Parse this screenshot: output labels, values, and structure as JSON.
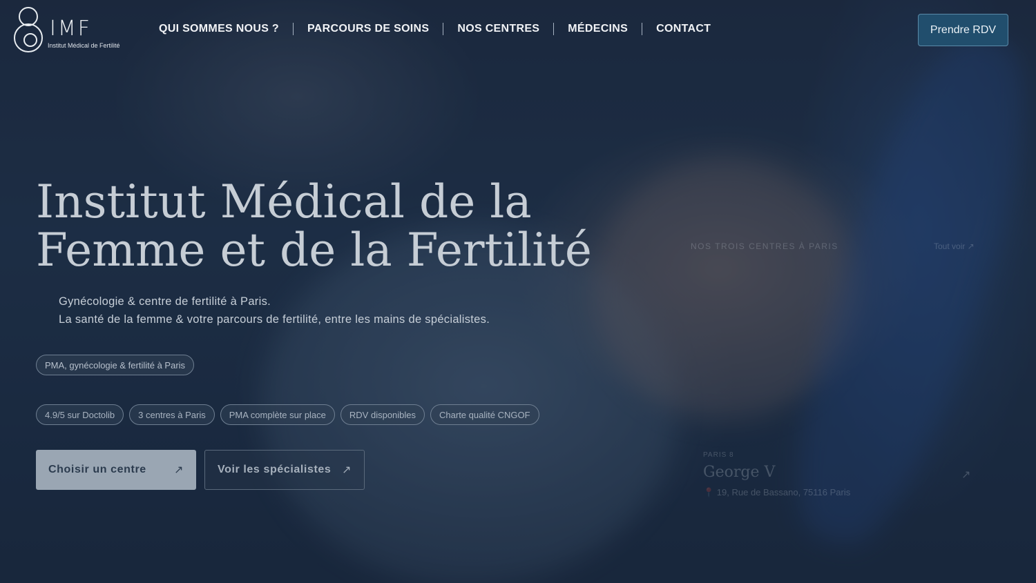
{
  "logo": {
    "title": "IMF",
    "subtitle": "Institut Médical de Fertilité"
  },
  "nav": {
    "items": [
      {
        "label": "QUI SOMMES NOUS ?"
      },
      {
        "label": "PARCOURS DE SOINS"
      },
      {
        "label": "NOS CENTRES"
      },
      {
        "label": "MÉDECINS"
      },
      {
        "label": "CONTACT"
      }
    ]
  },
  "header": {
    "cta_label": "Prendre RDV"
  },
  "hero": {
    "title_line1": "Institut Médical de la",
    "title_line2": "Femme et de la Fertilité",
    "subtitle_line1": "Gynécologie & centre de fertilité à Paris.",
    "subtitle_line2": "La santé de la femme & votre parcours de fertilité, entre les mains de spécialistes.",
    "tag": "PMA, gynécologie & fertilité à Paris",
    "badges": [
      {
        "label": "4.9/5 sur Doctolib"
      },
      {
        "label": "3 centres à Paris"
      },
      {
        "label": "PMA complète sur place"
      },
      {
        "label": "RDV disponibles"
      },
      {
        "label": "Charte qualité CNGOF"
      }
    ],
    "primary_button": "Choisir un centre",
    "secondary_button": "Voir les spécialistes",
    "arrow_glyph": "↗"
  },
  "center_card": {
    "heading": "NOS TROIS CENTRES À PARIS",
    "link": "Tout voir ↗",
    "label": "PARIS 8",
    "name": "George V",
    "address": "📍 19, Rue de Bassano, 75116 Paris",
    "arrow_glyph": "↗"
  },
  "colors": {
    "background": "#1c2a3e",
    "cta": "#214e6d",
    "primary_button": "#9aa6b3"
  }
}
